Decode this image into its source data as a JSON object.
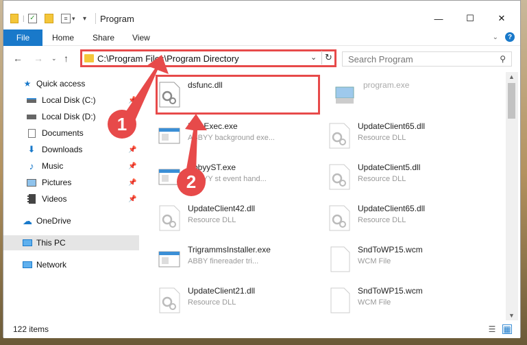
{
  "window": {
    "title": "Program",
    "controls": {
      "minimize": "—",
      "maximize": "☐",
      "close": "✕"
    }
  },
  "ribbon": {
    "tabs": [
      "File",
      "Home",
      "Share",
      "View"
    ],
    "help": "?"
  },
  "address": {
    "path": "C:\\Program Files\\Program Directory",
    "dropdown": "⌄",
    "refresh": "↻"
  },
  "search": {
    "placeholder": "Search Program"
  },
  "sidebar": {
    "items": [
      {
        "label": "Quick access",
        "icon": "star-icon"
      },
      {
        "label": "Local Disk (C:)",
        "icon": "drive-icon"
      },
      {
        "label": "Local Disk (D:)",
        "icon": "drive-icon"
      },
      {
        "label": "Documents",
        "icon": "document-icon"
      },
      {
        "label": "Downloads",
        "icon": "download-icon"
      },
      {
        "label": "Music",
        "icon": "music-icon"
      },
      {
        "label": "Pictures",
        "icon": "pictures-icon"
      },
      {
        "label": "Videos",
        "icon": "video-icon"
      },
      {
        "label": "OneDrive",
        "icon": "cloud-icon"
      },
      {
        "label": "This PC",
        "icon": "computer-icon"
      },
      {
        "label": "Network",
        "icon": "network-icon"
      }
    ]
  },
  "files": [
    {
      "name": "dsfunc.dll",
      "desc": "",
      "icon": "dll-gear-icon"
    },
    {
      "name": "program.exe",
      "desc": "",
      "icon": "exe-icon"
    },
    {
      "name": "FineExec.exe",
      "desc": "ABBYY background exe...",
      "icon": "exe-window-icon"
    },
    {
      "name": "UpdateClient65.dll",
      "desc": "Resource DLL",
      "icon": "dll-gear-icon"
    },
    {
      "name": "AbbyyST.exe",
      "desc": "ABBYY st event hand...",
      "icon": "exe-window-icon"
    },
    {
      "name": "UpdateClient5.dll",
      "desc": "Resource DLL",
      "icon": "dll-gear-icon"
    },
    {
      "name": "UpdateClient42.dll",
      "desc": "Resource DLL",
      "icon": "dll-gear-icon"
    },
    {
      "name": "UpdateClient65.dll",
      "desc": "Resource DLL",
      "icon": "dll-gear-icon"
    },
    {
      "name": "TrigrammsInstaller.exe",
      "desc": "ABBY finereader tri...",
      "icon": "exe-window-icon"
    },
    {
      "name": "SndToWP15.wcm",
      "desc": "WCM File",
      "icon": "blank-file-icon"
    },
    {
      "name": "UpdateClient21.dll",
      "desc": "Resource DLL",
      "icon": "dll-gear-icon"
    },
    {
      "name": "SndToWP15.wcm",
      "desc": "WCM File",
      "icon": "blank-file-icon"
    }
  ],
  "status": {
    "count": "122 items"
  },
  "annotations": {
    "badge1": "1",
    "badge2": "2"
  },
  "colors": {
    "accent": "#1979ca",
    "annotation": "#e74a4a",
    "folder": "#f4c63a"
  }
}
